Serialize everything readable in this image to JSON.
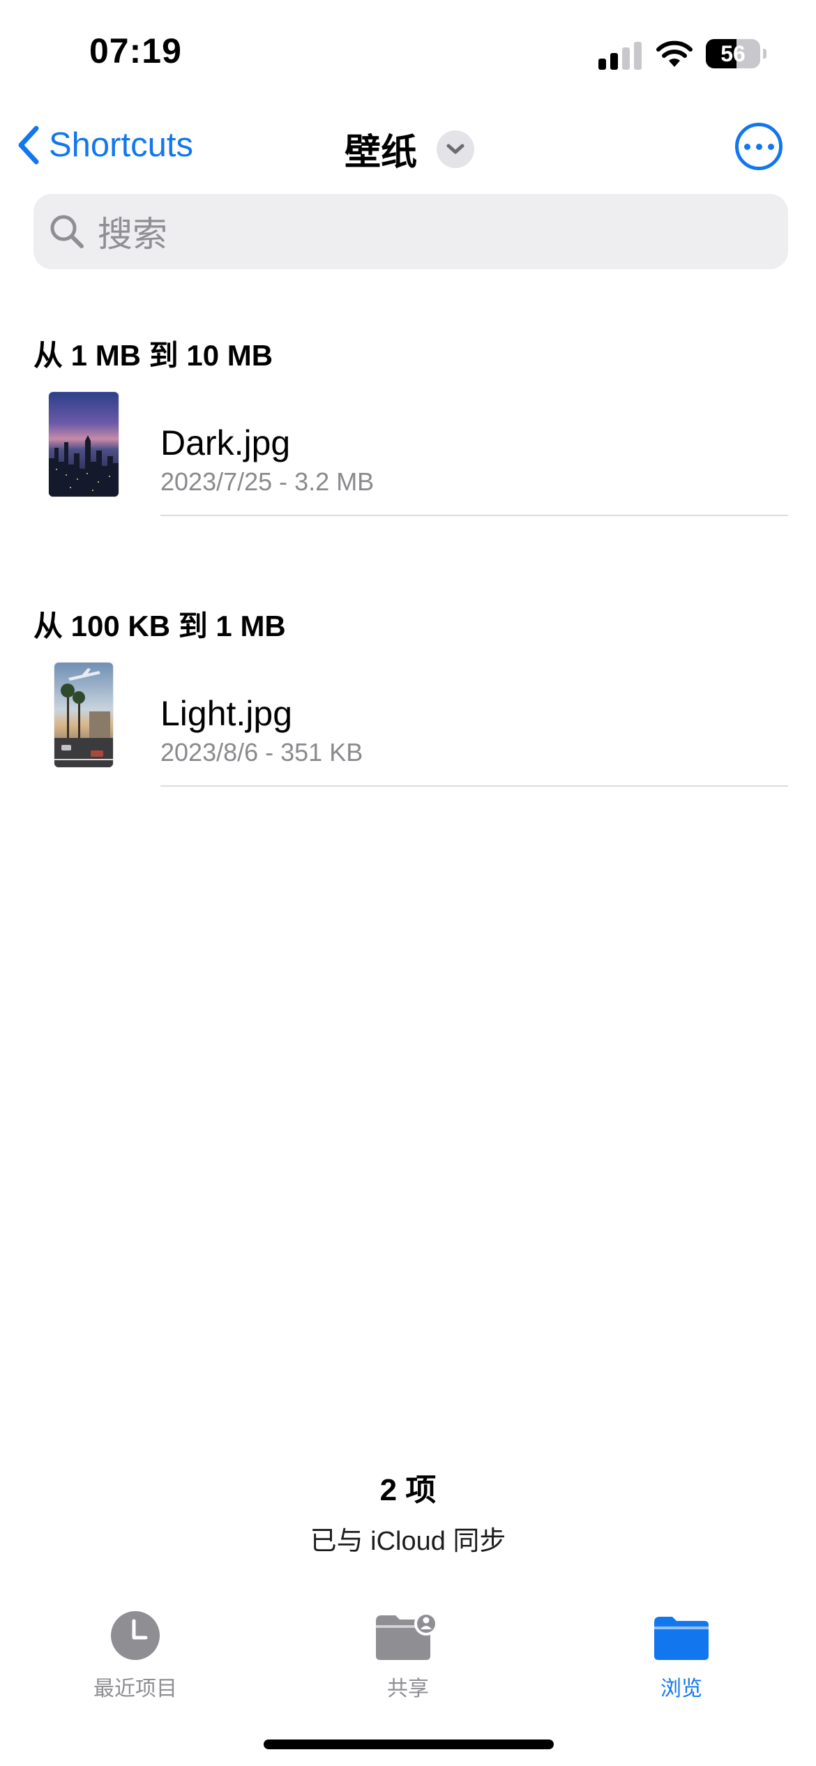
{
  "status_bar": {
    "time": "07:19",
    "battery": "56"
  },
  "nav": {
    "back_label": "Shortcuts",
    "title": "壁纸"
  },
  "search": {
    "placeholder": "搜索"
  },
  "sections": [
    {
      "header": "从 1 MB 到 10 MB",
      "file": {
        "name": "Dark.jpg",
        "meta": "2023/7/25 - 3.2 MB"
      }
    },
    {
      "header": "从 100 KB 到 1 MB",
      "file": {
        "name": "Light.jpg",
        "meta": "2023/8/6 - 351 KB"
      }
    }
  ],
  "footer": {
    "count": "2 项",
    "sync": "已与 iCloud 同步"
  },
  "tabs": [
    {
      "label": "最近项目",
      "icon": "clock-icon",
      "active": false
    },
    {
      "label": "共享",
      "icon": "shared-folder-icon",
      "active": false
    },
    {
      "label": "浏览",
      "icon": "folder-icon",
      "active": true
    }
  ],
  "colors": {
    "accent": "#1277ee",
    "secondary_text": "#8a8a8e",
    "search_bg": "#eeeef0"
  }
}
